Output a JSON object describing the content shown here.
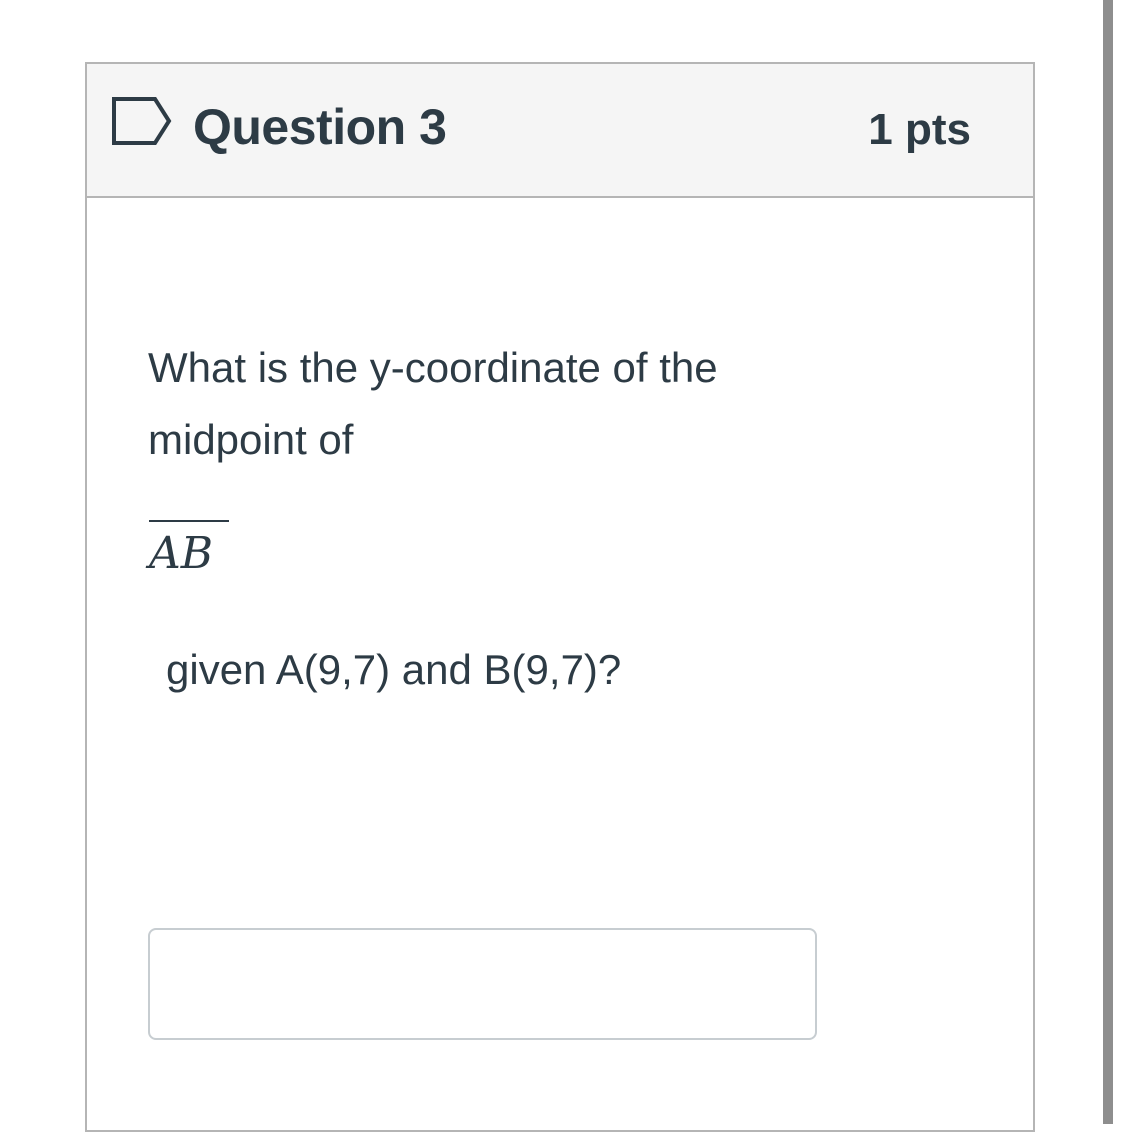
{
  "question": {
    "title": "Question 3",
    "points": "1 pts",
    "prompt": "What is the y-coordinate of the midpoint of",
    "segment": "AB",
    "given": "given A(9,7) and B(9,7)?",
    "flag_icon": "flag-outline-icon"
  },
  "answer": {
    "value": "",
    "placeholder": ""
  },
  "colors": {
    "text": "#2d3b45",
    "header_bg": "#f5f5f5",
    "border": "#b5b5b5",
    "input_border": "#c7cdd1"
  }
}
